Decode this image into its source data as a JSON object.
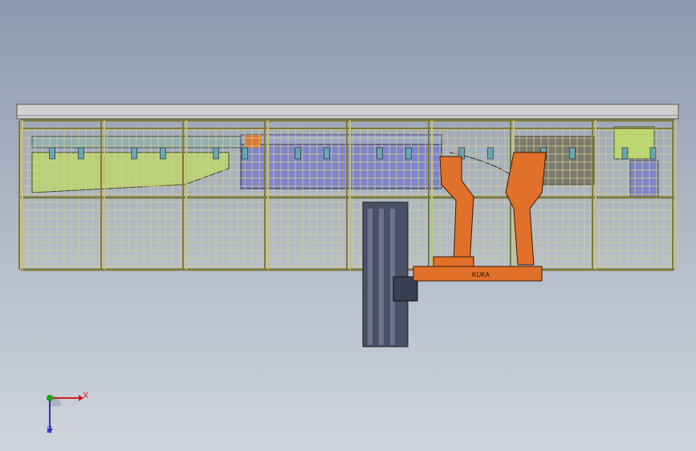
{
  "viewport": {
    "background_top": "#8d99ad",
    "background_bottom": "#cfd4dc"
  },
  "model": {
    "frame_color": "#c8c06e",
    "frame_post_color": "#7e7a3c",
    "roof_color": "#c9c9c9",
    "mesh_color": "#d8cf84",
    "left_machine_color": "#b9cf7a",
    "center_machine_color": "#7f85c9",
    "right_machine_color": "#b8d86c",
    "robot_color": "#e0702a",
    "column_color": "#4a5066",
    "robot_brand": "KUKA"
  },
  "triad": {
    "x_label": "X",
    "z_label": "Z",
    "x_color": "#d11a1a",
    "y_color": "#1aa31a",
    "z_color": "#2b2bd0"
  }
}
